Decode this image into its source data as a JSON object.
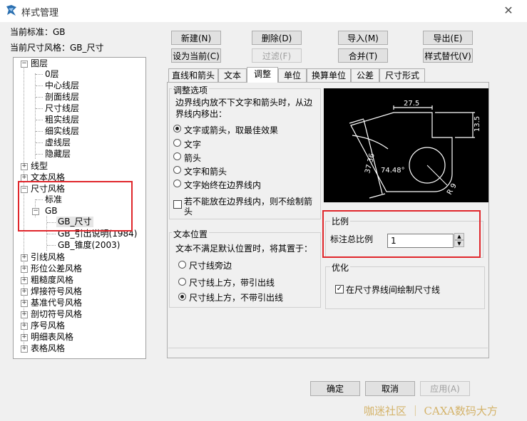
{
  "window": {
    "title": "样式管理",
    "close": "✕"
  },
  "header": {
    "current_standard": "当前标准：GB",
    "current_dim_style": "当前尺寸风格：GB_尺寸"
  },
  "buttons": {
    "new": "新建(N)",
    "delete": "删除(D)",
    "import": "导入(M)",
    "export": "导出(E)",
    "set_current": "设为当前(C)",
    "filter": "过滤(F)",
    "merge": "合并(T)",
    "style_replace": "样式替代(V)",
    "ok": "确定",
    "cancel": "取消",
    "apply": "应用(A)"
  },
  "tree": {
    "layers": {
      "label": "图层",
      "children": [
        "0层",
        "中心线层",
        "剖面线层",
        "尺寸线层",
        "粗实线层",
        "细实线层",
        "虚线层",
        "隐藏层"
      ]
    },
    "linetype": "线型",
    "text_style": "文本风格",
    "dim_style": {
      "label": "尺寸风格",
      "standard": "标准",
      "gb": "GB",
      "gb_children": [
        "GB_尺寸",
        "GB_引出说明(1984)",
        "GB_锥度(2003)"
      ]
    },
    "others": [
      "引线风格",
      "形位公差风格",
      "粗糙度风格",
      "焊接符号风格",
      "基准代号风格",
      "剖切符号风格",
      "序号风格",
      "明细表风格",
      "表格风格"
    ]
  },
  "tabs": [
    "直线和箭头",
    "文本",
    "调整",
    "单位",
    "换算单位",
    "公差",
    "尺寸形式"
  ],
  "active_tab": "调整",
  "adjust": {
    "group_title": "调整选项",
    "description": "边界线内放不下文字和箭头时，从边界线内移出：",
    "options": [
      "文字或箭头，取最佳效果",
      "文字",
      "箭头",
      "文字和箭头",
      "文字始终在边界线内"
    ],
    "selected_index": 0,
    "no_arrow_checkbox": "若不能放在边界线内，则不绘制箭头",
    "no_arrow_checked": false
  },
  "text_position": {
    "group_title": "文本位置",
    "description": "文本不满足默认位置时，将其置于：",
    "options": [
      "尺寸线旁边",
      "尺寸线上方，带引出线",
      "尺寸线上方，不带引出线"
    ],
    "selected_index": 2
  },
  "scale": {
    "group_title": "比例",
    "label": "标注总比例",
    "value": "1"
  },
  "optimize": {
    "group_title": "优化",
    "checkbox": "在尺寸界线间绘制尺寸线",
    "checked": true
  },
  "preview": {
    "dim_top": "27.5",
    "dim_right": "13.5",
    "dim_left": "37.36",
    "angle": "74.48°",
    "radius": "R 9"
  },
  "watermark": "咖迷社区 ｜ CAXA数码大方",
  "colors": {
    "highlight": "#e0262b",
    "preview_bg": "#000000",
    "preview_line": "#ffffff"
  }
}
